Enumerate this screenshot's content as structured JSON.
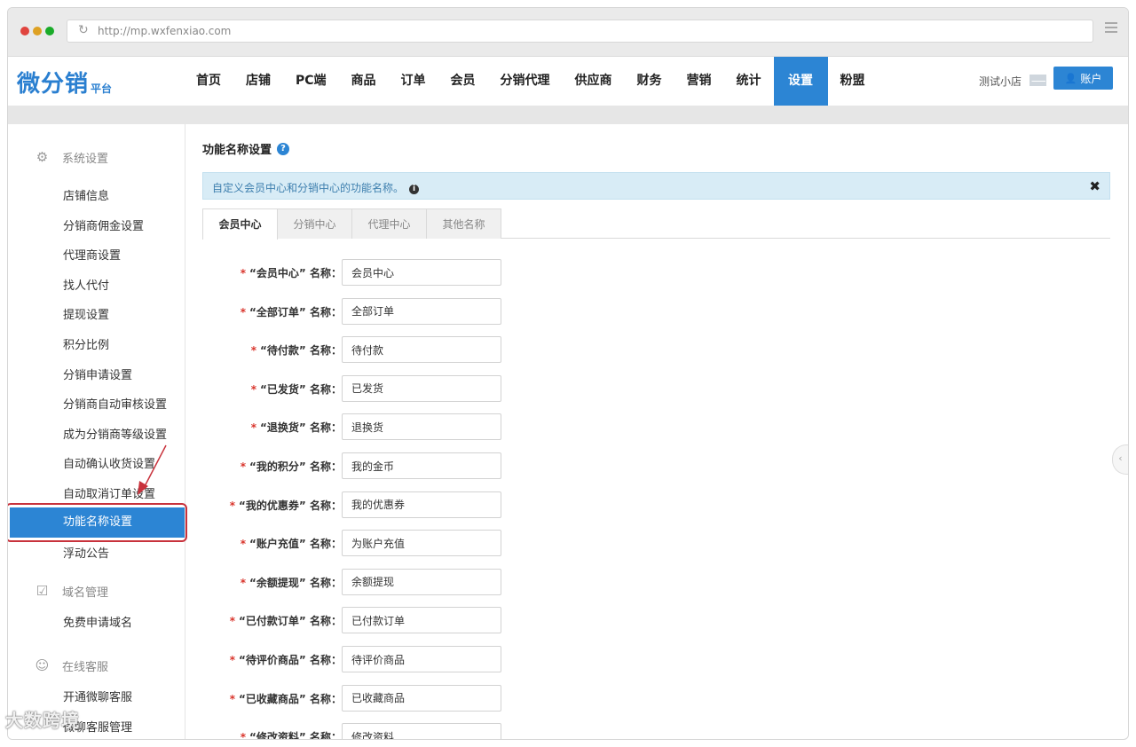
{
  "browser": {
    "url": "http://mp.wxfenxiao.com"
  },
  "logo": {
    "main": "微分销",
    "sub": "平台"
  },
  "nav": {
    "items": [
      {
        "label": "首页"
      },
      {
        "label": "店铺"
      },
      {
        "label": "PC端"
      },
      {
        "label": "商品"
      },
      {
        "label": "订单"
      },
      {
        "label": "会员"
      },
      {
        "label": "分销代理"
      },
      {
        "label": "供应商"
      },
      {
        "label": "财务"
      },
      {
        "label": "营销"
      },
      {
        "label": "统计"
      },
      {
        "label": "设置"
      },
      {
        "label": "粉盟"
      }
    ],
    "active": "设置",
    "shop_name": "测试小店",
    "account_label": "账户"
  },
  "sidebar": {
    "sections": [
      {
        "title": "系统设置",
        "icon": "gear-icon",
        "items": [
          "店铺信息",
          "分销商佣金设置",
          "代理商设置",
          "找人代付",
          "提现设置",
          "积分比例",
          "分销申请设置",
          "分销商自动审核设置",
          "成为分销商等级设置",
          "自动确认收货设置",
          "自动取消订单设置",
          "功能名称设置",
          "浮动公告"
        ]
      },
      {
        "title": "域名管理",
        "icon": "checkbox-icon",
        "items": [
          "免费申请域名"
        ]
      },
      {
        "title": "在线客服",
        "icon": "chat-icon",
        "items": [
          "开通微聊客服",
          "微聊客服管理"
        ]
      }
    ],
    "active_item": "功能名称设置"
  },
  "main": {
    "title": "功能名称设置",
    "notice": "自定义会员中心和分销中心的功能名称。",
    "tabs": [
      "会员中心",
      "分销中心",
      "代理中心",
      "其他名称"
    ],
    "active_tab": "会员中心",
    "fields": [
      {
        "label": "“会员中心” 名称：",
        "value": "会员中心"
      },
      {
        "label": "“全部订单” 名称：",
        "value": "全部订单"
      },
      {
        "label": "“待付款” 名称：",
        "value": "待付款"
      },
      {
        "label": "“已发货” 名称：",
        "value": "已发货"
      },
      {
        "label": "“退换货” 名称：",
        "value": "退换货"
      },
      {
        "label": "“我的积分” 名称：",
        "value": "我的金币"
      },
      {
        "label": "“我的优惠券” 名称：",
        "value": "我的优惠券"
      },
      {
        "label": "“账户充值” 名称：",
        "value": "为账户充值"
      },
      {
        "label": "“余额提现” 名称：",
        "value": "余额提现"
      },
      {
        "label": "“已付款订单” 名称：",
        "value": "已付款订单"
      },
      {
        "label": "“待评价商品” 名称：",
        "value": "待评价商品"
      },
      {
        "label": "“已收藏商品” 名称：",
        "value": "已收藏商品"
      },
      {
        "label": "“修改资料” 名称：",
        "value": "修改资料"
      }
    ]
  },
  "watermark": "大数跨境",
  "colors": {
    "accent": "#2c85d4",
    "highlight": "#c8323c",
    "required": "#d9342b"
  }
}
